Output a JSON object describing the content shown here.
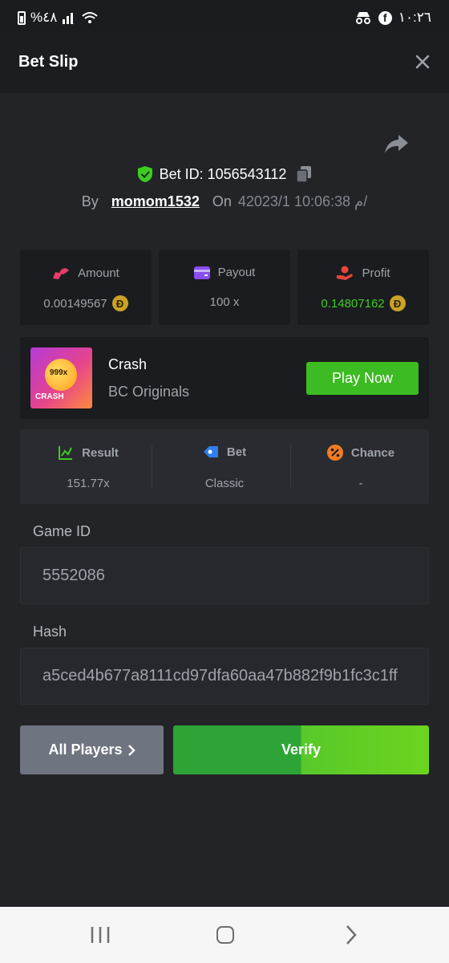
{
  "status_bar": {
    "battery_percent": "%٤٨",
    "time": "١٠:٢٦",
    "facebook_glyph": "f"
  },
  "header": {
    "title": "Bet Slip",
    "close_icon": "close-icon"
  },
  "bet": {
    "bet_id": "Bet ID: 1056543112",
    "by_label": "By",
    "username": "momom1532",
    "on_label": "On",
    "datetime": "4م 10:06:38 2023/1/"
  },
  "stats": {
    "amount": {
      "label": "Amount",
      "value": "0.00149567",
      "coin": "Ð"
    },
    "payout": {
      "label": "Payout",
      "value": "100 x"
    },
    "profit": {
      "label": "Profit",
      "value": "0.14807162",
      "coin": "Ð"
    }
  },
  "game": {
    "name": "Crash",
    "provider": "BC Originals",
    "thumb_badge": "999x",
    "thumb_label": "CRASH",
    "play_label": "Play Now"
  },
  "result": {
    "result": {
      "label": "Result",
      "value": "151.77x"
    },
    "bet": {
      "label": "Bet",
      "value": "Classic"
    },
    "chance": {
      "label": "Chance",
      "value": "-"
    }
  },
  "game_id": {
    "label": "Game ID",
    "value": "5552086"
  },
  "hash": {
    "label": "Hash",
    "value": "a5ced4b677a8111cd97dfa60aa47b882f9b1fc3c1ff"
  },
  "buttons": {
    "all_players": "All Players",
    "verify": "Verify"
  },
  "colors": {
    "profit_green": "#3dcc22",
    "play_green": "#3dbb22",
    "coin_gold": "#c9a227"
  }
}
